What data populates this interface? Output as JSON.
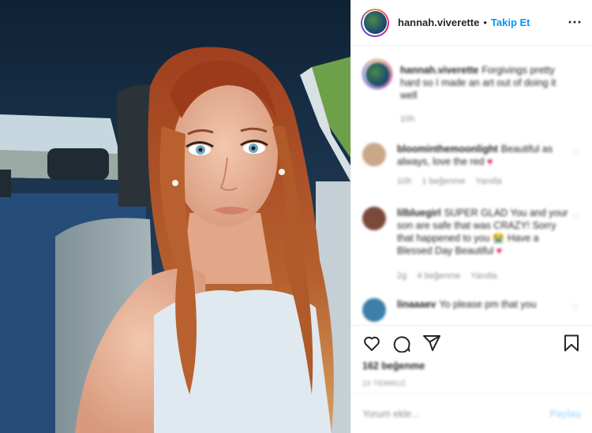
{
  "post": {
    "username": "hannah.viverette",
    "separator": "•",
    "follow_label": "Takip Et",
    "more_icon": "more-icon"
  },
  "caption": {
    "username": "hannah.viverette",
    "text": "Forgivings pretty hard so I made an art out of doing it well",
    "time": "10h"
  },
  "comments": [
    {
      "username": "bloominthemoonlight",
      "text": "Beautiful as always, love the red",
      "emoji": "♥",
      "time": "10h",
      "likes": "1 beğenme",
      "reply": "Yanıtla",
      "avatar_color": "#c9a88a"
    },
    {
      "username": "lilbluegirl",
      "text": "SUPER GLAD You and your son are safe that was CRAZY! Sorry that happened to you 😭 Have a Blessed Day Beautiful",
      "emoji": "♥",
      "time": "2g",
      "likes": "4 beğenme",
      "reply": "Yanıtla",
      "avatar_color": "#7a4a3a"
    },
    {
      "username": "linaaaev",
      "text": "Yo please pm that you",
      "emoji": "",
      "time": "",
      "likes": "",
      "reply": "",
      "avatar_color": "#3d7fa8"
    }
  ],
  "actions": {
    "like_icon": "heart-icon",
    "comment_icon": "comment-icon",
    "share_icon": "share-icon",
    "save_icon": "bookmark-icon",
    "likes_text": "162 beğenme",
    "time_text": "10 TEMMUZ"
  },
  "add_comment": {
    "placeholder": "Yorum ekle...",
    "post_label": "Paylaş"
  },
  "colors": {
    "accent": "#0095f6",
    "heart": "#e0245e"
  }
}
